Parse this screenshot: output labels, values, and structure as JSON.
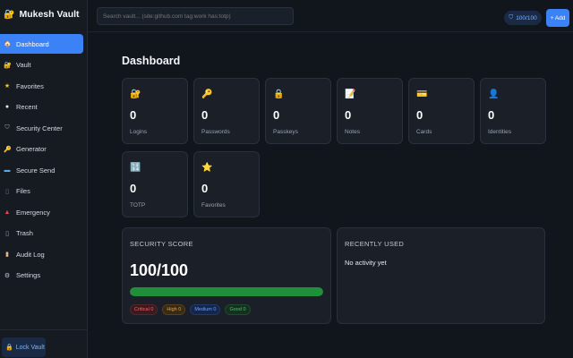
{
  "app": {
    "title": "Mukesh Vault",
    "logo_icon": "lock-icon"
  },
  "sidebar": {
    "items": [
      {
        "label": "Dashboard",
        "icon": "home-icon",
        "glyph": "🏠",
        "active": true
      },
      {
        "label": "Vault",
        "icon": "lock-icon",
        "glyph": "🔐",
        "active": false
      },
      {
        "label": "Favorites",
        "icon": "star-icon",
        "glyph": "★",
        "active": false
      },
      {
        "label": "Recent",
        "icon": "clock-icon",
        "glyph": "●",
        "active": false
      },
      {
        "label": "Security Center",
        "icon": "shield-icon",
        "glyph": "⛉",
        "active": false
      },
      {
        "label": "Generator",
        "icon": "key-icon",
        "glyph": "🔑",
        "active": false
      },
      {
        "label": "Secure Send",
        "icon": "send-icon",
        "glyph": "▬",
        "active": false
      },
      {
        "label": "Files",
        "icon": "file-icon",
        "glyph": "▯",
        "active": false
      },
      {
        "label": "Emergency",
        "icon": "alert-icon",
        "glyph": "▲",
        "active": false
      },
      {
        "label": "Trash",
        "icon": "trash-icon",
        "glyph": "▯",
        "active": false
      },
      {
        "label": "Audit Log",
        "icon": "log-icon",
        "glyph": "▮",
        "active": false
      },
      {
        "label": "Settings",
        "icon": "gear-icon",
        "glyph": "⚙",
        "active": false
      }
    ],
    "lock_label": "Lock Vault"
  },
  "topbar": {
    "search_placeholder": "Search vault... (site:github.com tag:work has:totp)",
    "score_label": "100/100",
    "add_label": "+ Add"
  },
  "dashboard": {
    "title": "Dashboard",
    "cards": [
      {
        "label": "Logins",
        "count": "0",
        "icon": "lock-icon",
        "glyph": "🔐"
      },
      {
        "label": "Passwords",
        "count": "0",
        "icon": "key-icon",
        "glyph": "🔑"
      },
      {
        "label": "Passkeys",
        "count": "0",
        "icon": "padlock-icon",
        "glyph": "🔒"
      },
      {
        "label": "Notes",
        "count": "0",
        "icon": "note-icon",
        "glyph": "📝"
      },
      {
        "label": "Cards",
        "count": "0",
        "icon": "credit-card-icon",
        "glyph": "💳"
      },
      {
        "label": "Identities",
        "count": "0",
        "icon": "person-icon",
        "glyph": "👤"
      },
      {
        "label": "TOTP",
        "count": "0",
        "icon": "numbers-icon",
        "glyph": "🔢"
      },
      {
        "label": "Favorites",
        "count": "0",
        "icon": "star-icon",
        "glyph": "⭐"
      }
    ],
    "security": {
      "title": "SECURITY SCORE",
      "score": "100/100",
      "progress": 1.0,
      "chips": [
        {
          "label": "Critical 0",
          "kind": "critical"
        },
        {
          "label": "High 0",
          "kind": "high"
        },
        {
          "label": "Medium 0",
          "kind": "medium"
        },
        {
          "label": "Good 0",
          "kind": "good"
        }
      ]
    },
    "recent": {
      "title": "RECENTLY USED",
      "empty_text": "No activity yet"
    }
  },
  "colors": {
    "accent": "#3b82f6",
    "score_green": "#1f8f3a",
    "background": "#11151c",
    "sidebar": "#161b22"
  }
}
